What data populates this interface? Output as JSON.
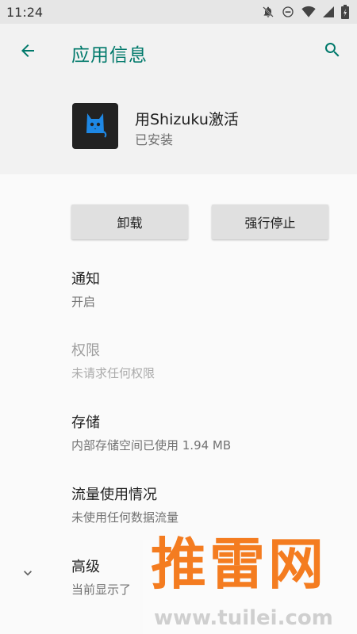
{
  "status_bar": {
    "time": "11:24",
    "icons": [
      "notifications-off-icon",
      "do-not-disturb-icon",
      "wifi-icon",
      "signal-icon",
      "battery-icon"
    ]
  },
  "app_bar": {
    "title": "应用信息",
    "back_icon": "arrow-back-icon",
    "search_icon": "search-icon"
  },
  "app": {
    "name": "用Shizuku激活",
    "status": "已安装",
    "icon": "cat-icon"
  },
  "buttons": {
    "uninstall": "卸载",
    "force_stop": "强行停止"
  },
  "prefs": [
    {
      "title": "通知",
      "summary": "开启",
      "enabled": true
    },
    {
      "title": "权限",
      "summary": "未请求任何权限",
      "enabled": false
    },
    {
      "title": "存储",
      "summary": "内部存储空间已使用 1.94 MB",
      "enabled": true
    },
    {
      "title": "流量使用情况",
      "summary": "未使用任何数据流量",
      "enabled": true
    },
    {
      "title": "高级",
      "summary": "当前显示了",
      "enabled": true
    }
  ],
  "watermark": {
    "title": "推雷网",
    "url": "www.tuilei.com"
  },
  "colors": {
    "accent": "#00796b",
    "app_icon_bg": "#222222",
    "app_icon_fg": "#1e88e5",
    "watermark": "#f47c20"
  }
}
